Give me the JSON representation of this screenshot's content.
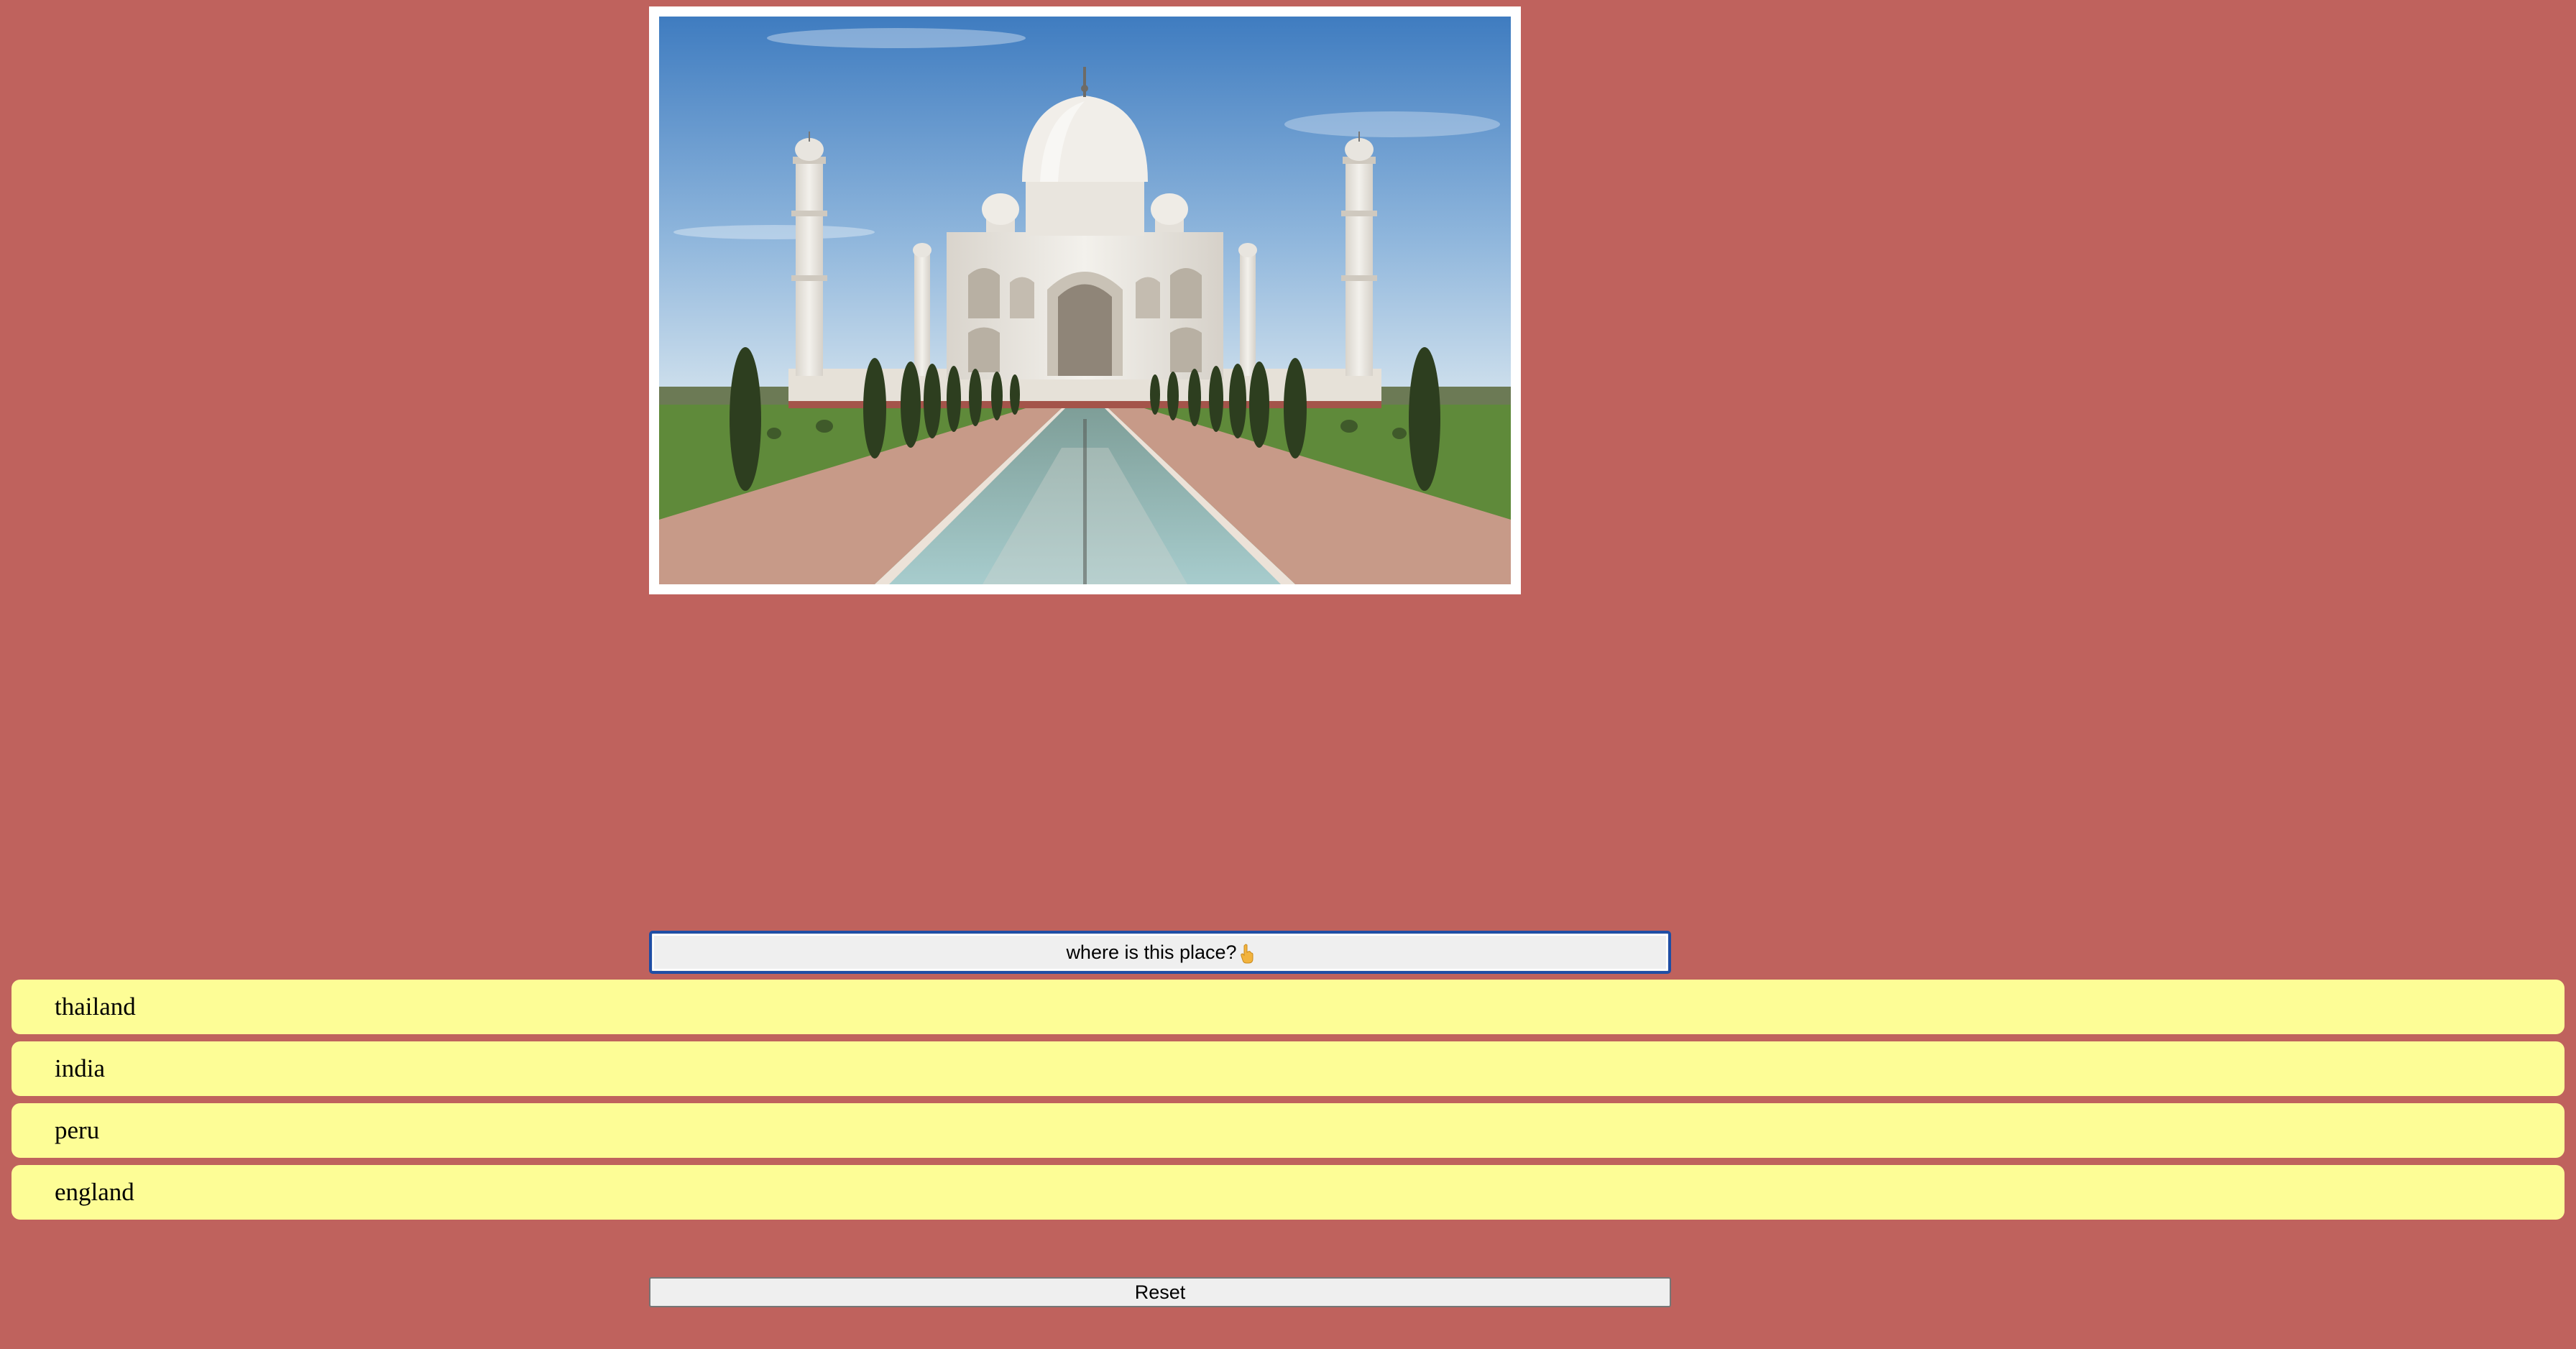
{
  "quiz": {
    "image": {
      "subject": "taj-mahal",
      "colors": {
        "sky_top": "#4a86c6",
        "sky_bottom": "#cfe0ee",
        "marble": "#ece9e3",
        "garden": "#5f8a3a",
        "water": "#8fb7b8",
        "path": "#b98a78"
      }
    },
    "question_label": "where is this place?",
    "question_icon": "pointing-hand-icon",
    "options": [
      {
        "label": "thailand"
      },
      {
        "label": "india"
      },
      {
        "label": "peru"
      },
      {
        "label": "england"
      }
    ],
    "reset_label": "Reset"
  },
  "theme": {
    "background": "#bf625d",
    "option_background": "#fdfd96",
    "button_background": "#efefef",
    "focus_ring": "#1f4ea5"
  }
}
